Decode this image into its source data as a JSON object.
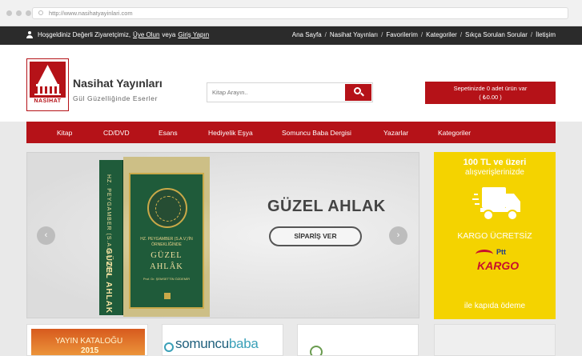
{
  "browser": {
    "url": "http://www.nasihatyayinlari.com"
  },
  "topbar": {
    "welcome_text": "Hoşgeldiniz Değerli Ziyaretçimiz,",
    "register_link": "Üye Olun",
    "or_text": "veya",
    "login_link": "Giriş Yapın",
    "nav": [
      "Ana Sayfa",
      "Nasihat Yayınları",
      "Favorilerim",
      "Kategoriler",
      "Sıkça Sorulan Sorular",
      "İletişim"
    ],
    "separator": "/"
  },
  "header": {
    "logo_text": "NASİHAT",
    "brand_name": "Nasihat Yayınları",
    "tagline": "Gül Güzelliğinde Eserler",
    "search_placeholder": "Kitap Arayın..",
    "cart_line1": "Sepetinizde 0 adet ürün var",
    "cart_line2": "( ₺0.00 )"
  },
  "main_nav": [
    "Kitap",
    "CD/DVD",
    "Esans",
    "Hediyelik Eşya",
    "Somuncu Baba Dergisi",
    "Yazarlar",
    "Kategoriler"
  ],
  "slider": {
    "title": "GÜZEL AHLAK",
    "button_label": "SİPARİŞ VER",
    "prev_arrow": "‹",
    "next_arrow": "›",
    "book": {
      "spine_author": "HZ. PEYGAMBER (S.A.V.) DEN",
      "spine_title": "GÜZEL AHLAK",
      "subtitle": "HZ. PEYGAMBER (S.A.V.)'İN ÖRNEKLİĞİNDE",
      "title_line1": "GÜZEL",
      "title_line2": "AHLÂK",
      "author": "Prof. Dr. ŞEMSETTİN ÖZDEMİR"
    }
  },
  "promo": {
    "line1": "100 TL ve üzeri",
    "line2": "alışverişlerinizde",
    "line3": "KARGO ÜCRETSİZ",
    "ptt_brand": "Ptt",
    "ptt_kargo": "KARGO",
    "line4": "ile kapıda ödeme"
  },
  "cards": {
    "catalog_line1": "YAYIN KATALOĞU",
    "catalog_line2": "2015",
    "somuncu_a": "somuncu",
    "somuncu_b": "baba"
  },
  "colors": {
    "brand_red": "#b51218",
    "promo_yellow": "#f4d300",
    "topbar_dark": "#2b2b2b"
  }
}
